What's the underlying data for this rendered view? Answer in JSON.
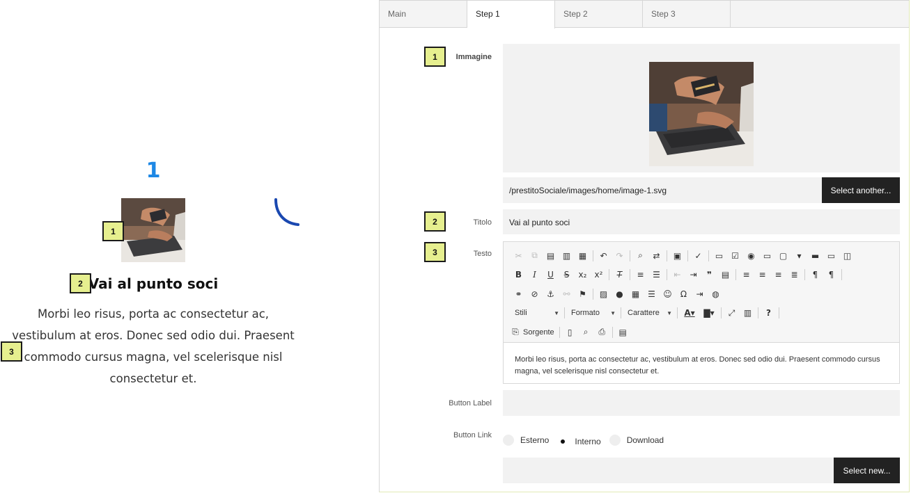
{
  "preview": {
    "step_number": "1",
    "title": "Vai al punto soci",
    "text": "Morbi leo risus, porta ac consectetur ac, vestibulum at eros. Donec sed odio dui. Praesent commodo cursus magna, vel scelerisque nisl consectetur et.",
    "accent_color": "#1e88e5",
    "markers": [
      "1",
      "2",
      "3"
    ]
  },
  "tabs": [
    {
      "label": "Main",
      "active": false
    },
    {
      "label": "Step 1",
      "active": true
    },
    {
      "label": "Step 2",
      "active": false
    },
    {
      "label": "Step 3",
      "active": false
    }
  ],
  "form": {
    "markers": [
      "1",
      "2",
      "3"
    ],
    "image_label": "Immagine",
    "image_path": "/prestitoSociale/images/home/image-1.svg",
    "select_another_label": "Select another...",
    "title_label": "Titolo",
    "title_value": "Vai al punto soci",
    "text_label": "Testo",
    "editor": {
      "combo_styles": "Stili",
      "combo_format": "Formato",
      "combo_font": "Carattere",
      "source_label": "Sorgente",
      "content": "Morbi leo risus, porta ac consectetur ac, vestibulum at eros. Donec sed odio dui. Praesent commodo cursus magna, vel scelerisque nisl consectetur et."
    },
    "button_label_label": "Button Label",
    "button_label_value": "",
    "button_link_label": "Button Link",
    "link_options": [
      {
        "label": "Esterno",
        "selected": false
      },
      {
        "label": "Interno",
        "selected": true
      },
      {
        "label": "Download",
        "selected": false
      }
    ],
    "link_value": "",
    "select_new_label": "Select new..."
  }
}
